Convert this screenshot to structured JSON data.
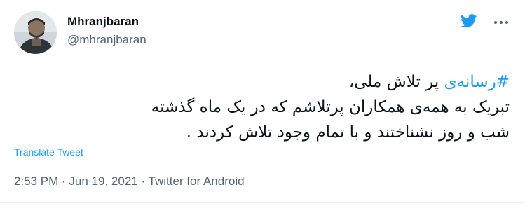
{
  "author": {
    "display_name": "Mhranjbaran",
    "handle": "@mhranjbaran"
  },
  "tweet": {
    "hashtag": "#رسانه‌ی",
    "line1_rest": " پر تلاش ملی،",
    "line2": "تبریک به همه‌ی همکاران پرتلاشم که در یک ماه گذشته",
    "line3": "شب و روز نشناختند و با تمام وجود تلاش کردند ."
  },
  "translate_label": "Translate Tweet",
  "meta": {
    "time": "2:53 PM",
    "separator": " · ",
    "date": "Jun 19, 2021",
    "source": "Twitter for Android"
  },
  "icons": {
    "brand": "twitter-bird-icon",
    "menu": "more-horizontal-icon"
  },
  "colors": {
    "accent": "#1d9bf0",
    "text": "#0f1419",
    "secondary": "#536471"
  }
}
